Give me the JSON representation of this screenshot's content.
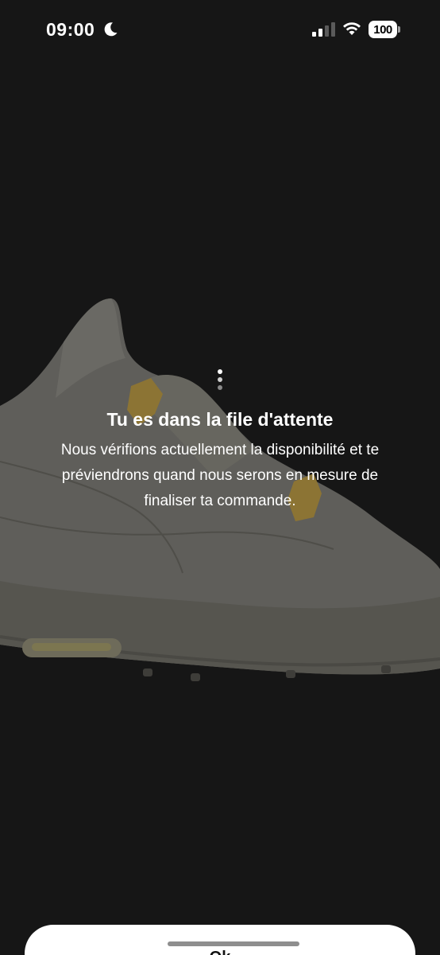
{
  "status_bar": {
    "time": "09:00",
    "moon_icon": "moon-icon",
    "signal_icon": "cellular-signal-icon",
    "wifi_icon": "wifi-icon",
    "battery_level": "100"
  },
  "background": {
    "image": "white-and-gold-sneaker"
  },
  "queue": {
    "loading_icon": "loading-dots-icon",
    "title": "Tu es dans la file d'attente",
    "message": "Nous vérifions actuellement la disponibilité et te préviendrons quand nous serons en mesure de finaliser ta commande."
  },
  "sheet": {
    "button_label": "Ok"
  },
  "colors": {
    "background": "#161616",
    "text": "#ffffff",
    "sheet": "#ffffff",
    "accent_gold": "#b8953f"
  }
}
